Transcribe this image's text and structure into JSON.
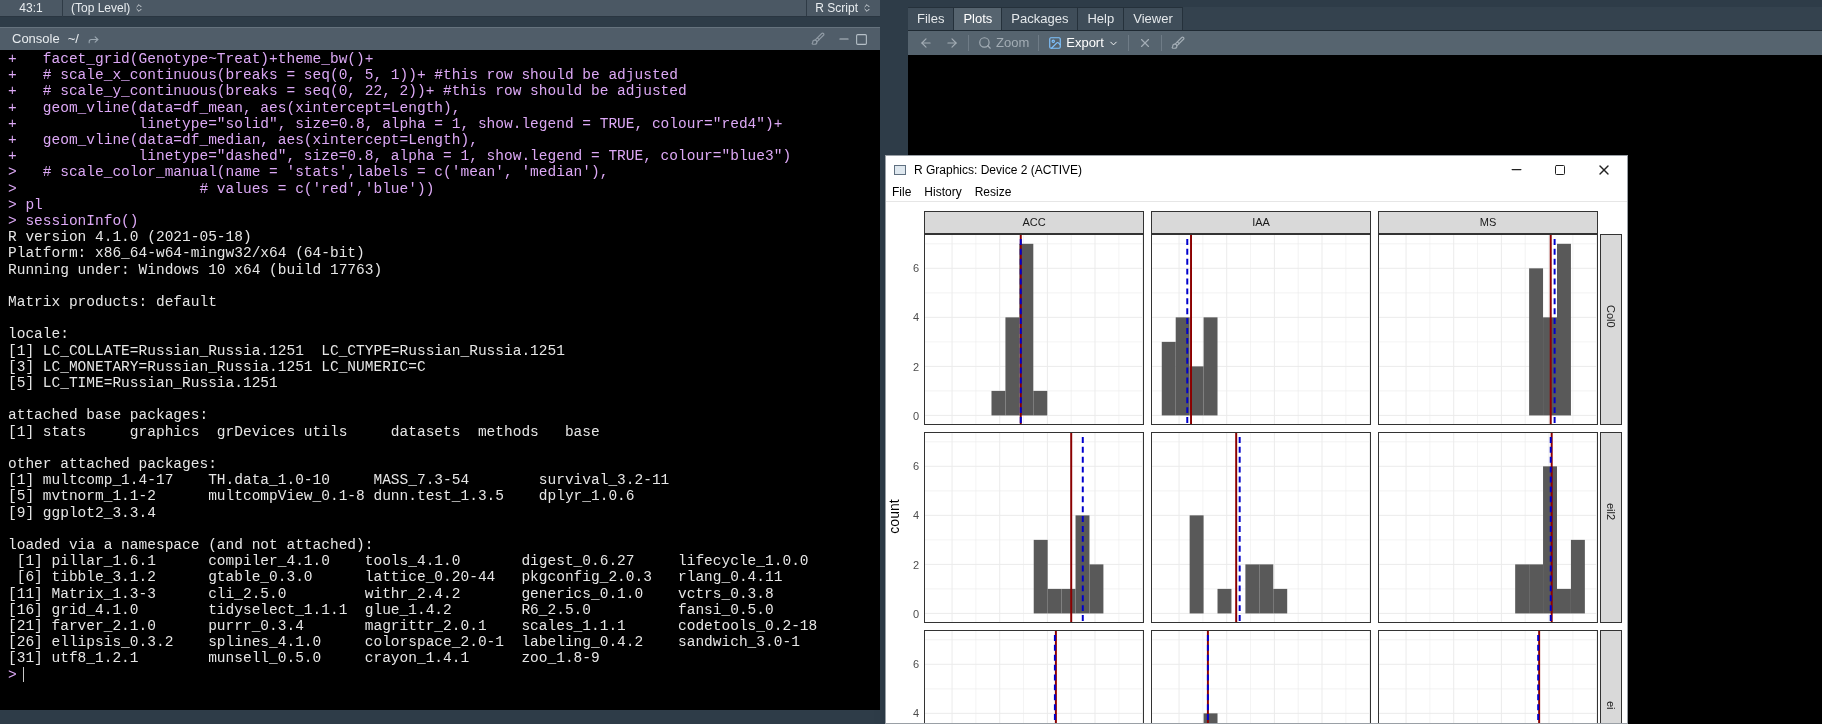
{
  "editor_status": {
    "position": "43:1",
    "scope": "(Top Level)",
    "file_type": "R Script"
  },
  "console": {
    "title": "Console",
    "path": "~/",
    "lines": [
      {
        "kind": "input",
        "text": "+   facet_grid(Genotype~Treat)+theme_bw()+"
      },
      {
        "kind": "input",
        "text": "+   # scale_x_continuous(breaks = seq(0, 5, 1))+ #this row should be adjusted"
      },
      {
        "kind": "input",
        "text": "+   # scale_y_continuous(breaks = seq(0, 22, 2))+ #this row should be adjusted"
      },
      {
        "kind": "input",
        "text": "+   geom_vline(data=df_mean, aes(xintercept=Length),"
      },
      {
        "kind": "input",
        "text": "+              linetype=\"solid\", size=0.8, alpha = 1, show.legend = TRUE, colour=\"red4\")+"
      },
      {
        "kind": "input",
        "text": "+   geom_vline(data=df_median, aes(xintercept=Length),"
      },
      {
        "kind": "input",
        "text": "+              linetype=\"dashed\", size=0.8, alpha = 1, show.legend = TRUE, colour=\"blue3\")"
      },
      {
        "kind": "input",
        "text": ">   # scale_color_manual(name = 'stats',labels = c('mean', 'median'),"
      },
      {
        "kind": "input",
        "text": ">                     # values = c('red','blue'))"
      },
      {
        "kind": "input",
        "text": "> pl"
      },
      {
        "kind": "input",
        "text": "> sessionInfo()"
      },
      {
        "kind": "output",
        "text": "R version 4.1.0 (2021-05-18)"
      },
      {
        "kind": "output",
        "text": "Platform: x86_64-w64-mingw32/x64 (64-bit)"
      },
      {
        "kind": "output",
        "text": "Running under: Windows 10 x64 (build 17763)"
      },
      {
        "kind": "blank"
      },
      {
        "kind": "output",
        "text": "Matrix products: default"
      },
      {
        "kind": "blank"
      },
      {
        "kind": "output",
        "text": "locale:"
      },
      {
        "kind": "output",
        "text": "[1] LC_COLLATE=Russian_Russia.1251  LC_CTYPE=Russian_Russia.1251"
      },
      {
        "kind": "output",
        "text": "[3] LC_MONETARY=Russian_Russia.1251 LC_NUMERIC=C"
      },
      {
        "kind": "output",
        "text": "[5] LC_TIME=Russian_Russia.1251"
      },
      {
        "kind": "blank"
      },
      {
        "kind": "output",
        "text": "attached base packages:"
      },
      {
        "kind": "output",
        "text": "[1] stats     graphics  grDevices utils     datasets  methods   base"
      },
      {
        "kind": "blank"
      },
      {
        "kind": "output",
        "text": "other attached packages:"
      },
      {
        "kind": "output",
        "text": "[1] multcomp_1.4-17    TH.data_1.0-10     MASS_7.3-54        survival_3.2-11"
      },
      {
        "kind": "output",
        "text": "[5] mvtnorm_1.1-2      multcompView_0.1-8 dunn.test_1.3.5    dplyr_1.0.6"
      },
      {
        "kind": "output",
        "text": "[9] ggplot2_3.3.4"
      },
      {
        "kind": "blank"
      },
      {
        "kind": "output",
        "text": "loaded via a namespace (and not attached):"
      },
      {
        "kind": "output",
        "text": " [1] pillar_1.6.1      compiler_4.1.0    tools_4.1.0       digest_0.6.27     lifecycle_1.0.0"
      },
      {
        "kind": "output",
        "text": " [6] tibble_3.1.2      gtable_0.3.0      lattice_0.20-44   pkgconfig_2.0.3   rlang_0.4.11"
      },
      {
        "kind": "output",
        "text": "[11] Matrix_1.3-3      cli_2.5.0         withr_2.4.2       generics_0.1.0    vctrs_0.3.8"
      },
      {
        "kind": "output",
        "text": "[16] grid_4.1.0        tidyselect_1.1.1  glue_1.4.2        R6_2.5.0          fansi_0.5.0"
      },
      {
        "kind": "output",
        "text": "[21] farver_2.1.0      purrr_0.3.4       magrittr_2.0.1    scales_1.1.1      codetools_0.2-18"
      },
      {
        "kind": "output",
        "text": "[26] ellipsis_0.3.2    splines_4.1.0     colorspace_2.0-1  labeling_0.4.2    sandwich_3.0-1"
      },
      {
        "kind": "output",
        "text": "[31] utf8_1.2.1        munsell_0.5.0     crayon_1.4.1      zoo_1.8-9"
      },
      {
        "kind": "prompt",
        "text": ">"
      }
    ]
  },
  "right_pane": {
    "tabs": [
      {
        "label": "Files",
        "selected": false
      },
      {
        "label": "Plots",
        "selected": true
      },
      {
        "label": "Packages",
        "selected": false
      },
      {
        "label": "Help",
        "selected": false
      },
      {
        "label": "Viewer",
        "selected": false
      }
    ],
    "toolbar": [
      {
        "kind": "back",
        "disabled": true
      },
      {
        "kind": "forward",
        "disabled": true
      },
      {
        "kind": "zoom",
        "label": "Zoom",
        "disabled": true
      },
      {
        "kind": "export",
        "label": "Export",
        "disabled": false
      },
      {
        "kind": "remove",
        "disabled": true
      },
      {
        "kind": "clear",
        "disabled": true
      }
    ]
  },
  "graphics_window": {
    "title": "R Graphics: Device 2 (ACTIVE)",
    "menu": [
      "File",
      "History",
      "Resize"
    ],
    "plot": {
      "ylabel": "count",
      "columns": [
        "ACC",
        "IAA",
        "MS"
      ],
      "rows": [
        {
          "label": "Col0",
          "y_ticks": [
            "6",
            "4",
            "2",
            "0"
          ]
        },
        {
          "label": "eil2",
          "y_ticks": [
            "6",
            "4",
            "2",
            "0"
          ]
        },
        {
          "label": "ei",
          "y_ticks": [
            "6",
            "4"
          ]
        }
      ]
    }
  }
}
